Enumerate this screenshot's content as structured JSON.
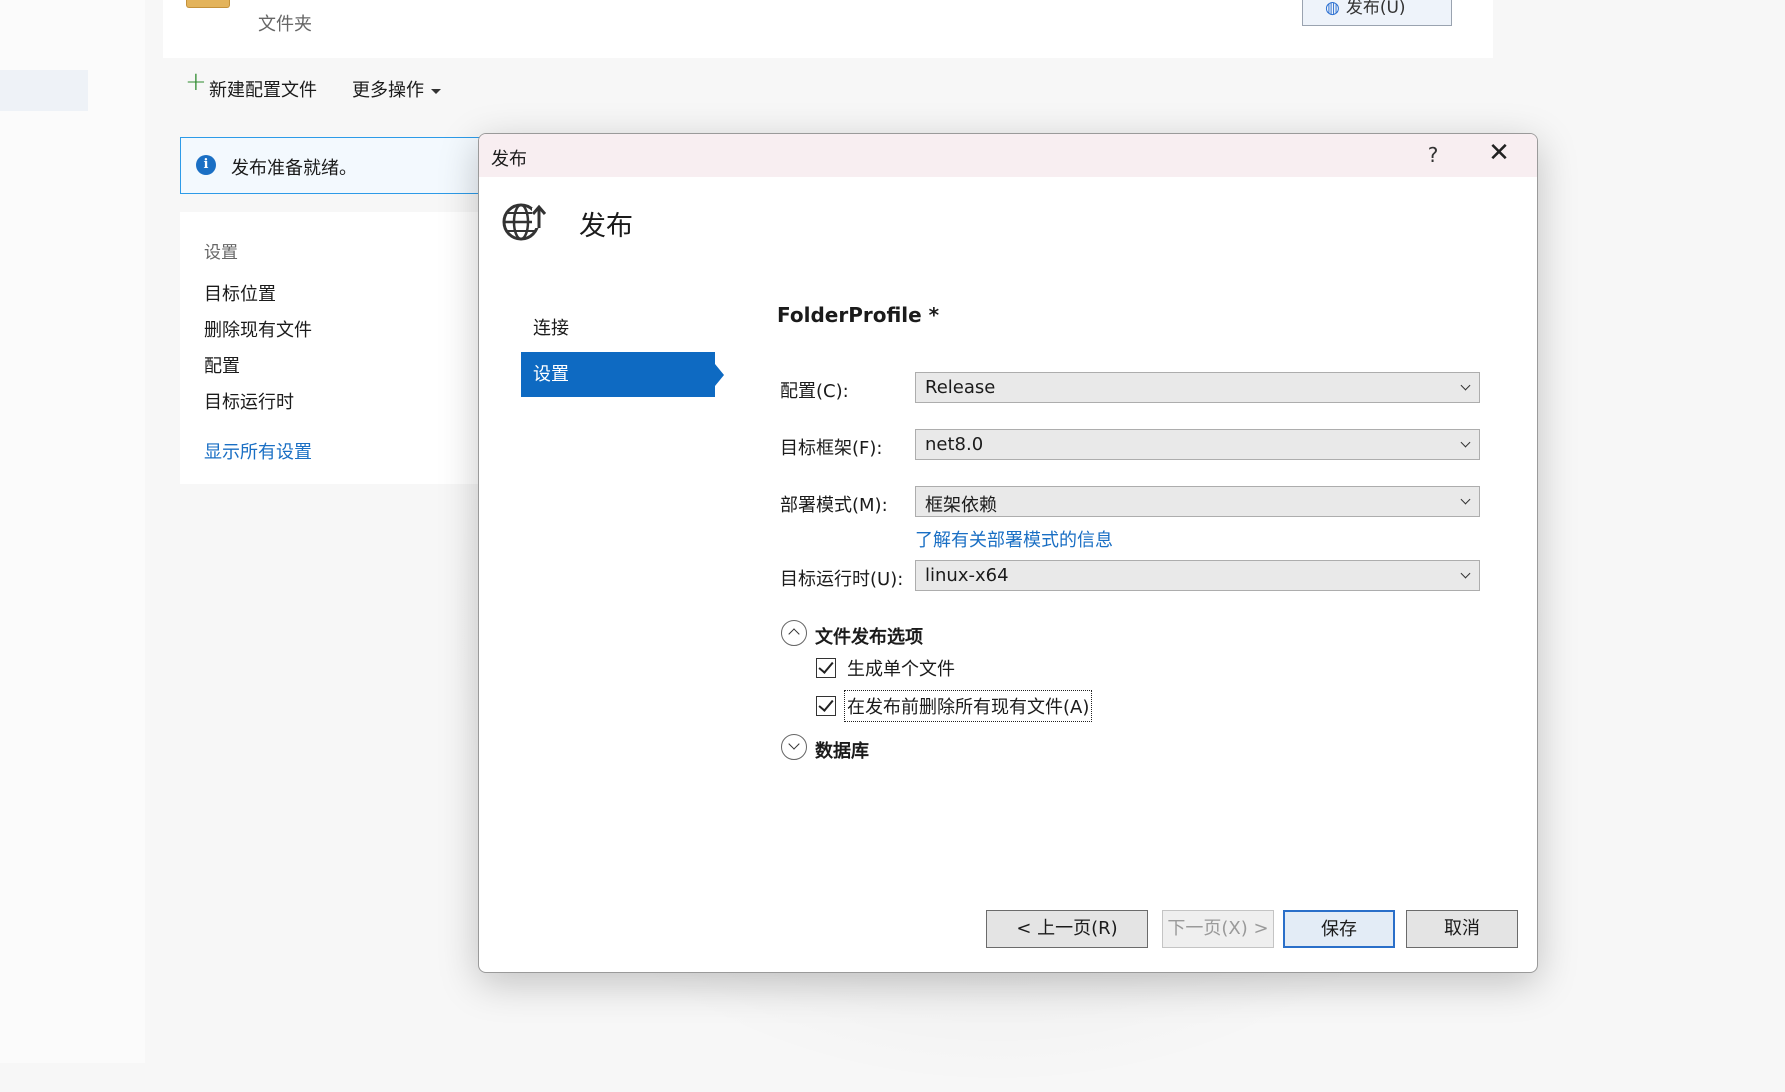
{
  "background": {
    "folder_subtitle": "文件夹",
    "publish_button_label": "发布(U)",
    "toolbar": {
      "new_profile_label": "新建配置文件",
      "more_actions_label": "更多操作"
    },
    "info_bar_text": "发布准备就绪。",
    "settings_panel": {
      "heading": "设置",
      "items": [
        "目标位置",
        "删除现有文件",
        "配置",
        "目标运行时"
      ],
      "show_all_link": "显示所有设置"
    }
  },
  "dialog": {
    "window_title": "发布",
    "help_glyph": "?",
    "close_glyph": "✕",
    "header_title": "发布",
    "nav": {
      "items": [
        "连接",
        "设置"
      ],
      "selected": "设置"
    },
    "profile_title": "FolderProfile *",
    "fields": {
      "configuration": {
        "label": "配置(C):",
        "value": "Release"
      },
      "target_framework": {
        "label": "目标框架(F):",
        "value": "net8.0"
      },
      "deployment_mode": {
        "label": "部署模式(M):",
        "value": "框架依赖"
      },
      "deployment_mode_link": "了解有关部署模式的信息",
      "target_runtime": {
        "label": "目标运行时(U):",
        "value": "linux-x64"
      }
    },
    "file_publish_options": {
      "title": "文件发布选项",
      "expanded": true,
      "options": [
        {
          "label": "生成单个文件",
          "checked": true
        },
        {
          "label": "在发布前删除所有现有文件(A)",
          "checked": true
        }
      ]
    },
    "database_section": {
      "title": "数据库",
      "expanded": false
    },
    "buttons": {
      "previous": "< 上一页(R)",
      "next": "下一页(X) >",
      "save": "保存",
      "cancel": "取消"
    }
  },
  "colors": {
    "accent_blue": "#0e6ac2",
    "link_blue": "#1a6fc4",
    "titlebar_bg": "#f8eef1",
    "info_border": "#2d9be8"
  }
}
